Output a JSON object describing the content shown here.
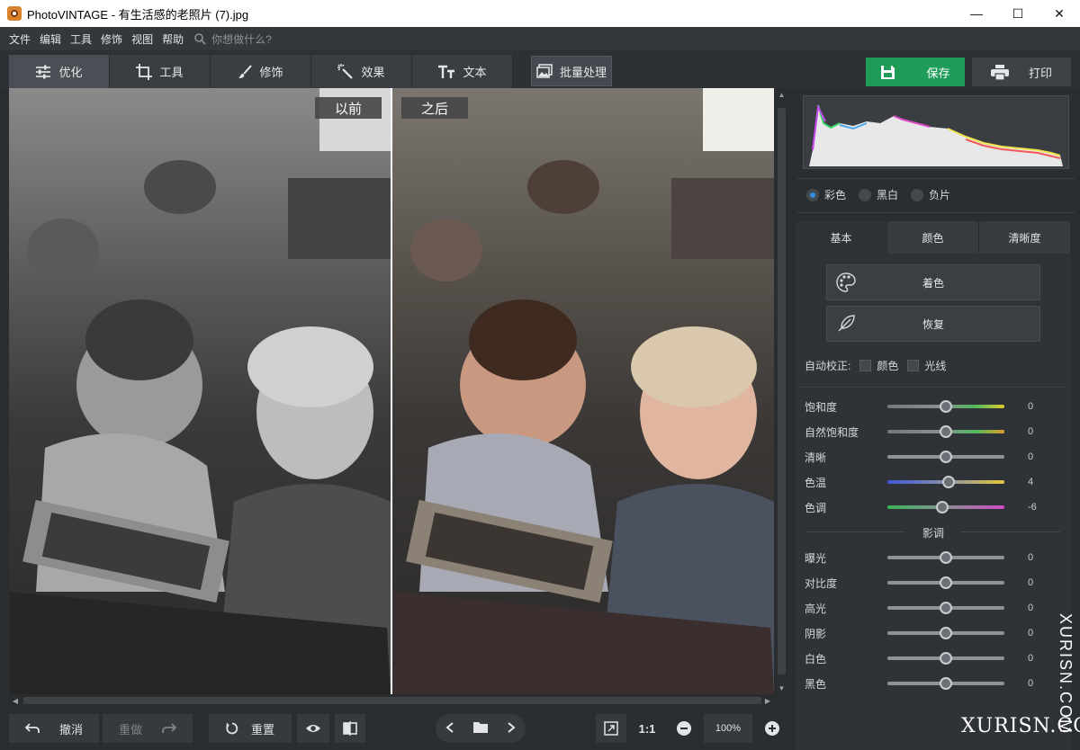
{
  "window": {
    "title": "PhotoVINTAGE - 有生活感的老照片 (7).jpg"
  },
  "menu": {
    "items": [
      "文件",
      "编辑",
      "工具",
      "修饰",
      "视图",
      "帮助"
    ],
    "search_placeholder": "你想做什么?"
  },
  "tabs": [
    {
      "label": "优化",
      "icon": "sliders-icon"
    },
    {
      "label": "工具",
      "icon": "crop-icon"
    },
    {
      "label": "修饰",
      "icon": "brush-icon"
    },
    {
      "label": "效果",
      "icon": "magic-wand-icon"
    },
    {
      "label": "文本",
      "icon": "text-icon"
    }
  ],
  "toolbar": {
    "batch_label": "批量处理",
    "save_label": "保存",
    "print_label": "打印"
  },
  "compare": {
    "before_label": "以前",
    "after_label": "之后"
  },
  "bottom": {
    "undo_label": "撤消",
    "redo_label": "重做",
    "reset_label": "重置",
    "ratio_label": "1:1",
    "zoom_value": "100%"
  },
  "panel": {
    "modes": [
      {
        "label": "彩色",
        "selected": true
      },
      {
        "label": "黑白",
        "selected": false
      },
      {
        "label": "负片",
        "selected": false
      }
    ],
    "tabs": [
      "基本",
      "颜色",
      "清晰度"
    ],
    "colorize_label": "着色",
    "restore_label": "恢复",
    "autofix": {
      "label": "自动校正:",
      "opt1": "颜色",
      "opt2": "光线"
    },
    "sliders": [
      {
        "label": "饱和度",
        "value": "0",
        "pos": 0.5,
        "track": "linear-gradient(90deg,#777 0%,#8a8f93 45%,#4fb85c 75%,#e0d02a 100%)"
      },
      {
        "label": "自然饱和度",
        "value": "0",
        "pos": 0.5,
        "track": "linear-gradient(90deg,#777 0%,#8a8f93 45%,#4fb85c 75%,#e0a02a 100%)"
      },
      {
        "label": "清晰",
        "value": "0",
        "pos": 0.5,
        "track": "#8f9398"
      },
      {
        "label": "色温",
        "value": "4",
        "pos": 0.52,
        "track": "linear-gradient(90deg,#3d58d8 0%,#8a8fa8 50%,#e2c63a 100%)"
      },
      {
        "label": "色调",
        "value": "-6",
        "pos": 0.47,
        "track": "linear-gradient(90deg,#37b55a 0%,#8a8f93 50%,#d04bc4 100%)"
      }
    ],
    "shadows_title": "影调",
    "light_sliders": [
      {
        "label": "曝光",
        "value": "0",
        "pos": 0.5
      },
      {
        "label": "对比度",
        "value": "0",
        "pos": 0.5
      },
      {
        "label": "高光",
        "value": "0",
        "pos": 0.5
      },
      {
        "label": "阴影",
        "value": "0",
        "pos": 0.5
      },
      {
        "label": "白色",
        "value": "0",
        "pos": 0.5
      },
      {
        "label": "黑色",
        "value": "0",
        "pos": 0.5
      }
    ]
  },
  "watermark": {
    "h": "XURISN.COM",
    "v": "XURISN.COM"
  }
}
